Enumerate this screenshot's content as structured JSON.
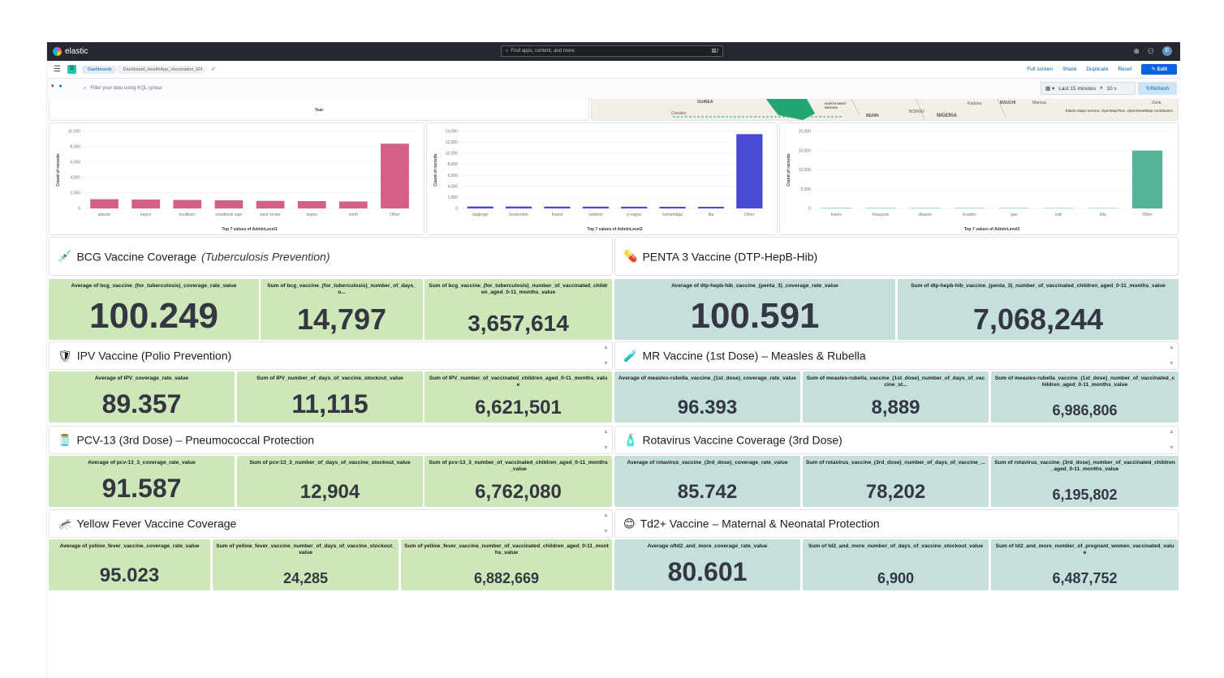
{
  "header": {
    "brand": "elastic",
    "search_placeholder": "Find apps, content, and more.",
    "search_kbd": "⌘/",
    "avatar": "E"
  },
  "nav": {
    "space_badge": "D",
    "breadcrumbs": [
      "Dashboards",
      "Dashboard_HealthApp_Vaccination_EN"
    ],
    "actions": [
      "Full screen",
      "Share",
      "Duplicate",
      "Reset"
    ],
    "edit_label": "Edit"
  },
  "query": {
    "placeholder": "Filter your data using KQL syntax",
    "time_label": "Last 15 minutes",
    "interval": "10 s",
    "refresh_label": "Refresh"
  },
  "top_strip": {
    "xlabel": "Year"
  },
  "map": {
    "labels": [
      "GUINEA",
      "Conakry",
      "NORTH WEST REGION",
      "BENIN",
      "BORGO",
      "NIGERIA",
      "Kaduna",
      "BAUCHI",
      "Maroua",
      "Zaria"
    ],
    "attribution": "Elastic Maps Service, OpenMapTiles, OpenStreetMap contributors"
  },
  "chart_data": [
    {
      "type": "bar",
      "title": "",
      "xlabel": "Top 7 values of AdminLevel1",
      "ylabel": "Count of records",
      "color": "#d36086",
      "categories": [
        "atlantic",
        "kayes",
        "koulikoro",
        "noudhesti ouje",
        "west center",
        "segou",
        "north",
        "Other"
      ],
      "values": [
        1200,
        1150,
        1100,
        1050,
        980,
        950,
        900,
        8400
      ],
      "yticks": [
        "0",
        "2,000",
        "4,000",
        "6,000",
        "8,000",
        "10,000"
      ],
      "ylim": [
        0,
        10000
      ]
    },
    {
      "type": "bar",
      "title": "",
      "xlabel": "Top 7 values of AdminLevel2",
      "ylabel": "Count of records",
      "color": "#4a49d4",
      "categories": [
        "bagbogo",
        "boukombe",
        "fouest",
        "yeberte",
        "p-vagou",
        "kumembga",
        "tita",
        "Other"
      ],
      "values": [
        350,
        340,
        330,
        320,
        310,
        300,
        290,
        13500
      ],
      "yticks": [
        "0",
        "2,000",
        "4,000",
        "6,000",
        "8,000",
        "10,000",
        "12,000",
        "14,000"
      ],
      "ylim": [
        0,
        14000
      ]
    },
    {
      "type": "bar",
      "title": "",
      "xlabel": "Top 7 values of AdminLevel3",
      "ylabel": "Count of records",
      "color": "#54b399",
      "categories": [
        "kayes",
        "bougouni",
        "sikasso",
        "kouribo",
        "gao",
        "kati",
        "kita",
        "Other"
      ],
      "values": [
        120,
        110,
        105,
        100,
        95,
        90,
        85,
        15000
      ],
      "yticks": [
        "0",
        "5,000",
        "10,000",
        "15,000",
        "20,000"
      ],
      "ylim": [
        0,
        20000
      ]
    }
  ],
  "sections": [
    {
      "icon": "💉",
      "title": "BCG Vaccine Coverage",
      "subtitle": "(Tuberculosis Prevention)"
    },
    {
      "icon": "💊",
      "title": "PENTA 3 Vaccine (DTP-HepB-Hib)"
    },
    {
      "icon": "🛡",
      "title": "IPV Vaccine (Polio Prevention)"
    },
    {
      "icon": "🧪",
      "title": "MR Vaccine (1st Dose) – Measles & Rubella"
    },
    {
      "icon": "🫙",
      "title": "PCV-13 (3rd Dose) – Pneumococcal Protection"
    },
    {
      "icon": "🧴",
      "title": "Rotavirus Vaccine Coverage (3rd Dose)"
    },
    {
      "icon": "🦟",
      "title": "Yellow Fever Vaccine Coverage"
    },
    {
      "icon": "😊",
      "title": "Td2+ Vaccine – Maternal & Neonatal Protection"
    }
  ],
  "metrics": [
    {
      "label": "Average of bcg_vaccine_(for_tuberculosis)_coverage_rate_value",
      "value": "100.249"
    },
    {
      "label": "Sum of bcg_vaccine_(for_tuberculosis)_number_of_days_o...",
      "value": "14,797"
    },
    {
      "label": "Sum of bcg_vaccine_(for_tuberculosis)_number_of_vaccinated_children_aged_0-11_months_value",
      "value": "3,657,614"
    },
    {
      "label": "Average of dtp-hepb-hib_vaccine_(penta_3)_coverage_rate_value",
      "value": "100.591"
    },
    {
      "label": "Sum of dtp-hepb-hib_vaccine_(penta_3)_number_of_vaccinated_children_aged_0-11_months_value",
      "value": "7,068,244"
    },
    {
      "label": "Average of IPV_coverage_rate_value",
      "value": "89.357"
    },
    {
      "label": "Sum of IPV_number_of_days_of_vaccine_stockout_value",
      "value": "11,115"
    },
    {
      "label": "Sum of IPV_number_of_vaccinated_children_aged_0-11_months_value",
      "value": "6,621,501"
    },
    {
      "label": "Average of measles-rubella_vaccine_(1st_dose)_coverage_rate_value",
      "value": "96.393"
    },
    {
      "label": "Sum of measles-rubella_vaccine_(1st_dose)_number_of_days_of_vaccine_st...",
      "value": "8,889"
    },
    {
      "label": "Sum of measles-rubella_vaccine_(1st_dose)_number_of_vaccinated_children_aged_0-11_months_value",
      "value": "6,986,806"
    },
    {
      "label": "Average of pcv-13_3_coverage_rate_value",
      "value": "91.587"
    },
    {
      "label": "Sum of pcv-13_3_number_of_days_of_vaccine_stockout_value",
      "value": "12,904"
    },
    {
      "label": "Sum of pcv-13_3_number_of_vaccinated_children_aged_0-11_months_value",
      "value": "6,762,080"
    },
    {
      "label": "Average of rotavirus_vaccine_(3rd_dose)_coverage_rate_value",
      "value": "85.742"
    },
    {
      "label": "Sum of rotavirus_vaccine_(3rd_dose)_number_of_days_of_vaccine_...",
      "value": "78,202"
    },
    {
      "label": "Sum of rotavirus_vaccine_(3rd_dose)_number_of_vaccinated_children_aged_0-11_months_value",
      "value": "6,195,802"
    },
    {
      "label": "Average of yellow_fever_vaccine_coverage_rate_value",
      "value": "95.023"
    },
    {
      "label": "Sum of yellow_fever_vaccine_number_of_days_of_vaccine_stockout_value",
      "value": "24,285"
    },
    {
      "label": "Sum of yellow_fever_vaccine_number_of_vaccinated_children_aged_0-11_months_value",
      "value": "6,882,669"
    },
    {
      "label": "Average oftd2_and_more_coverage_rate_value",
      "value": "80.601"
    },
    {
      "label": "Sum of td2_and_more_number_of_days_of_vaccine_stockout_value",
      "value": "6,900"
    },
    {
      "label": "Sum of td2_and_more_number_of_pregnant_women_vaccinated_value",
      "value": "6,487,752"
    }
  ]
}
